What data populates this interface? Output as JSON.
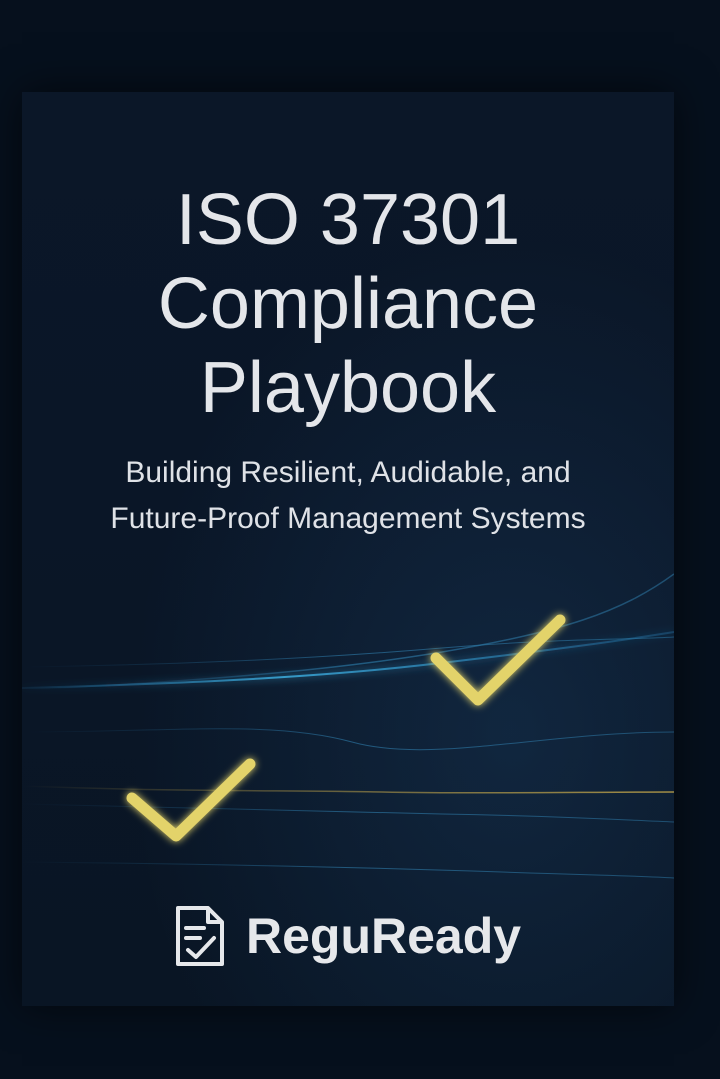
{
  "cover": {
    "title_lines": [
      "ISO 37301",
      "Compliance",
      "Playbook"
    ],
    "subtitle_lines": [
      "Building Resilient, Audidable,  and",
      "Future-Proof Management Systems"
    ],
    "brand_name": "ReguReady",
    "icons": [
      "checkmark-icon",
      "checkmark-icon",
      "document-check-icon"
    ],
    "colors": {
      "background": "#0a1627",
      "text": "#e4e6ea",
      "checkmark": "#e3d36a",
      "wave": "#3aa6d6"
    }
  }
}
